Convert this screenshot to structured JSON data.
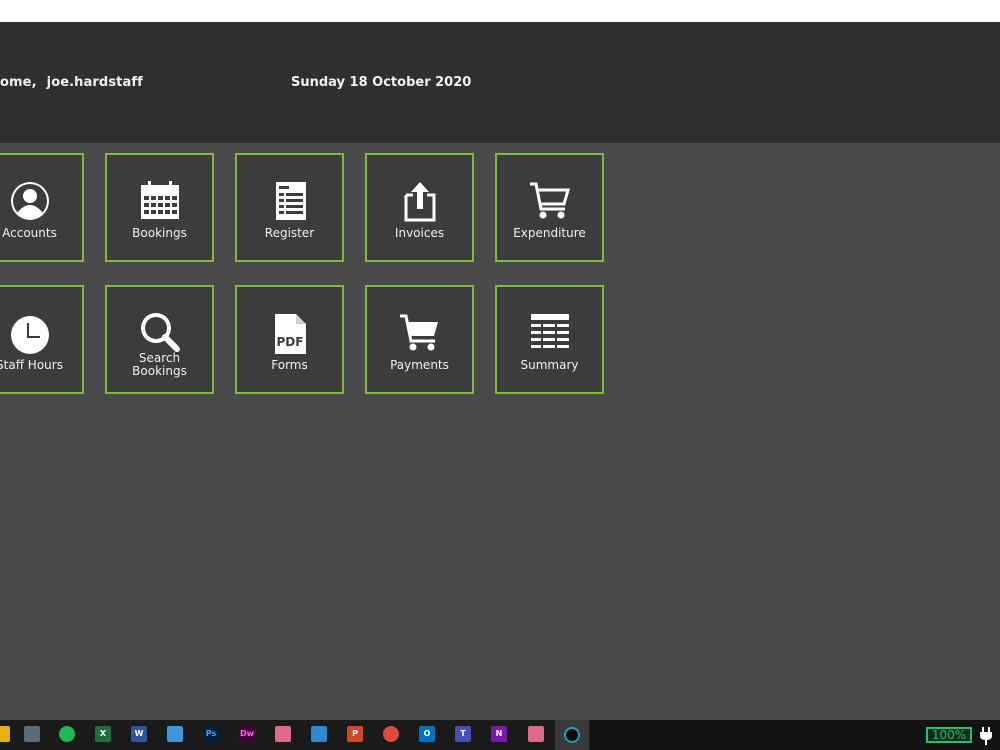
{
  "header": {
    "welcome_text": "ome,",
    "username": "joe.hardstaff",
    "date": "Sunday 18 October 2020"
  },
  "tiles": [
    {
      "label": "Accounts",
      "icon": "user-icon"
    },
    {
      "label": "Bookings",
      "icon": "calendar-icon"
    },
    {
      "label": "Register",
      "icon": "register-sheet-icon"
    },
    {
      "label": "Invoices",
      "icon": "share-upload-icon"
    },
    {
      "label": "Expenditure",
      "icon": "shopping-cart-icon"
    },
    {
      "label": "Staff Hours",
      "icon": "clock-icon"
    },
    {
      "label": "Search\nBookings",
      "icon": "search-icon"
    },
    {
      "label": "Forms",
      "icon": "pdf-icon"
    },
    {
      "label": "Payments",
      "icon": "shopping-cart-icon"
    },
    {
      "label": "Summary",
      "icon": "table-icon"
    }
  ],
  "taskbar": {
    "battery": "100%",
    "icon_labels": {
      "excel": "X",
      "word": "W",
      "photoshop": "Ps",
      "dreamweaver": "Dw",
      "powerpoint": "P",
      "outlook": "O",
      "teams": "T",
      "onenote": "N"
    },
    "colors": {
      "spotify": "#1db954",
      "excel": "#1d6f42",
      "word": "#2b579a",
      "photoshop": "#001e36",
      "dreamweaver": "#470137",
      "powerpoint": "#d24726",
      "outlook": "#0072c6",
      "teams": "#464eb8",
      "onenote": "#7719aa",
      "battery": "#25c06a"
    }
  }
}
